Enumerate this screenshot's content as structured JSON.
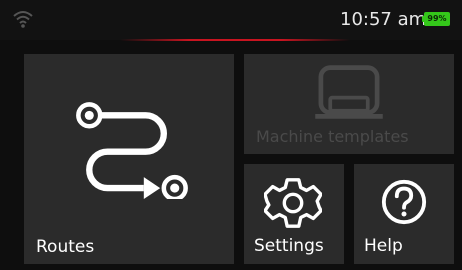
{
  "status_bar": {
    "time": "10:57 am",
    "battery_percent": "99%",
    "battery_level": 0.99,
    "wifi_icon": "wifi-icon",
    "accent_color": "#c81420",
    "battery_color": "#34c71a"
  },
  "tiles": {
    "routes": {
      "label": "Routes",
      "icon": "route-icon",
      "enabled": true
    },
    "machine_templates": {
      "label": "Machine templates",
      "icon": "machine-icon",
      "enabled": false
    },
    "settings": {
      "label": "Settings",
      "icon": "gear-icon",
      "enabled": true
    },
    "help": {
      "label": "Help",
      "icon": "help-icon",
      "enabled": true
    }
  }
}
